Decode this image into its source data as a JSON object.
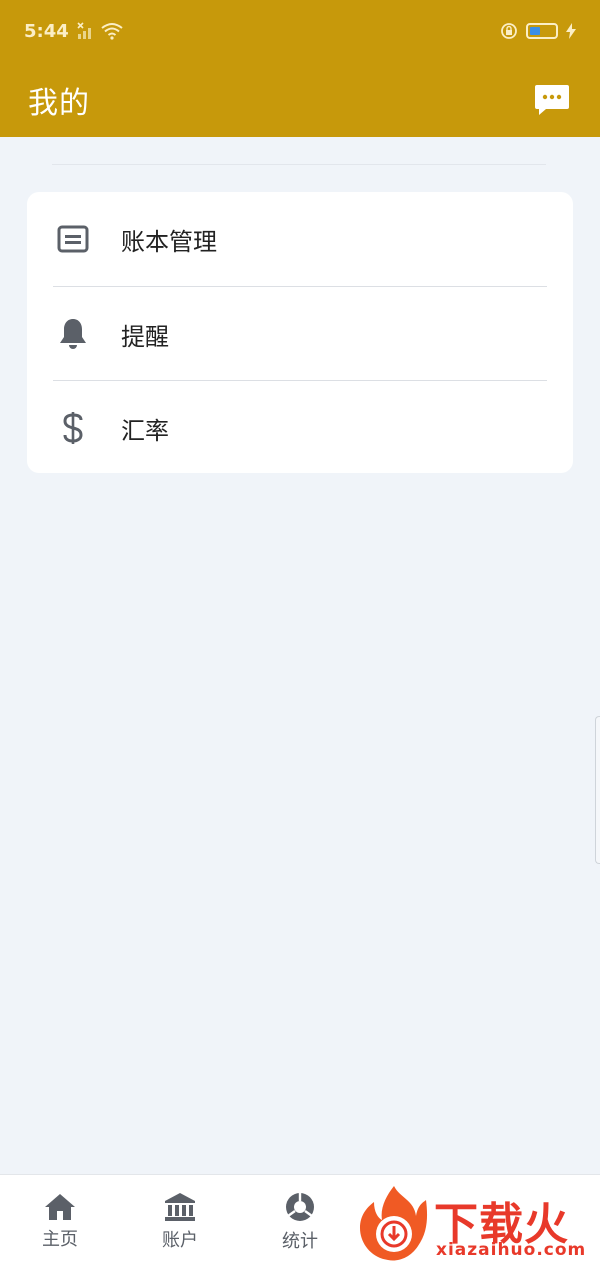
{
  "status_bar": {
    "time": "5:44"
  },
  "header": {
    "title": "我的"
  },
  "menu": {
    "items": [
      {
        "label": "账本管理",
        "icon": "list-icon"
      },
      {
        "label": "提醒",
        "icon": "bell-icon"
      },
      {
        "label": "汇率",
        "icon": "dollar-icon"
      }
    ]
  },
  "tabbar": {
    "tabs": [
      {
        "label": "主页",
        "icon": "home-icon"
      },
      {
        "label": "账户",
        "icon": "bank-icon"
      },
      {
        "label": "统计",
        "icon": "chart-icon"
      }
    ]
  },
  "watermark": {
    "text": "下载火",
    "subtext": "xiazaihuo.com"
  },
  "colors": {
    "header_bg": "#c7990b",
    "page_bg": "#f0f4f9",
    "card_bg": "#ffffff",
    "icon_gray": "#5b6068",
    "watermark_red": "#e8392a"
  }
}
